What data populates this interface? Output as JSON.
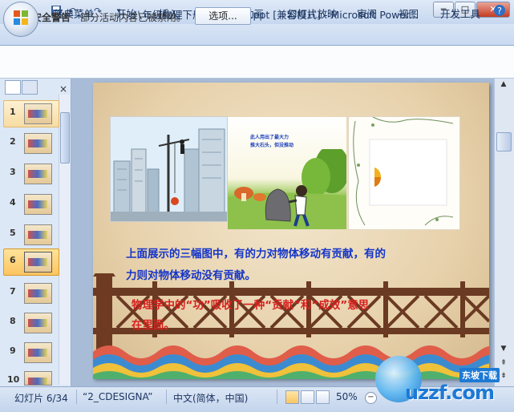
{
  "window": {
    "title": "八年级物理下册：11.1_功.ppt [兼容模式] - Microsoft Power...",
    "minimize": "─",
    "maximize": "□",
    "close": "✕"
  },
  "quick_access": {
    "save_icon": "save-icon",
    "undo_icon": "undo-icon",
    "redo_icon": "redo-icon"
  },
  "ribbon": {
    "tabs": [
      "经典菜单",
      "开始",
      "插入",
      "设计",
      "动画",
      "幻灯片放映",
      "审阅",
      "视图",
      "开发工具"
    ]
  },
  "security_bar": {
    "label": "安全警告",
    "message": "部分活动内容已被禁用。",
    "button": "选项..."
  },
  "slides_panel": {
    "numbers": [
      "1",
      "2",
      "3",
      "4",
      "5",
      "6",
      "7",
      "8",
      "9",
      "10"
    ],
    "selected": "6"
  },
  "slide": {
    "img1_caption": "",
    "img2_caption_line1": "此人用出了最大力",
    "img2_caption_line2": "推大石头，但没推动",
    "paragraph1_line1": "上面展示的三幅图中，有的力对物体移动有贡献，有的",
    "paragraph1_line2": "力则对物体移动没有贡献。",
    "paragraph2_line1": "物理学中的“功”吸收了一种“贡献”和“成效”意思",
    "paragraph2_line2": "在里面。"
  },
  "status_bar": {
    "slide_info": "幻灯片 6/34",
    "theme": "“2_CDESIGNA”",
    "language": "中文(简体，中国)",
    "zoom": "50%"
  },
  "watermark": {
    "text": "uzzf.com",
    "sub": "东坡下载"
  },
  "colors": {
    "accent": "#1535c9",
    "red_text": "#d6211e",
    "ribbon": "#c9d9f0"
  }
}
